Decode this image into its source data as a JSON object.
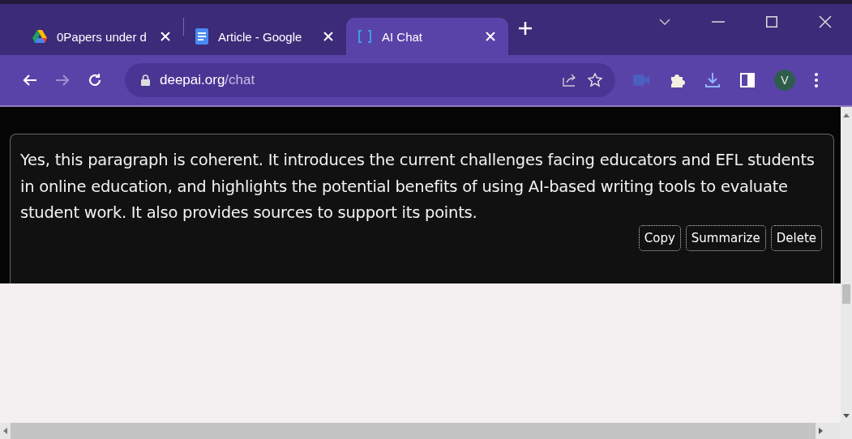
{
  "tabs": [
    {
      "kind": "drive",
      "title": "0Papers under d",
      "selected": false
    },
    {
      "kind": "docs",
      "title": "Article - Google",
      "selected": false
    },
    {
      "kind": "chat",
      "title": "AI Chat",
      "selected": true
    }
  ],
  "address": {
    "host": "deepai.org",
    "path": "/chat"
  },
  "profile": {
    "initial": "V"
  },
  "message": {
    "text": "Yes, this paragraph is coherent. It introduces the current challenges facing educators and EFL students in online education, and highlights the potential benefits of using AI-based writing tools to evaluate student work. It also provides sources to support its points.",
    "actions": [
      "Copy",
      "Summarize",
      "Delete"
    ]
  }
}
